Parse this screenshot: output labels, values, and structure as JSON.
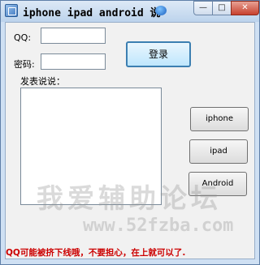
{
  "window": {
    "title": "iphone ipad android 说",
    "min_glyph": "—",
    "max_glyph": "□",
    "close_glyph": "✕"
  },
  "form": {
    "qq_label": "QQ:",
    "qq_value": "",
    "password_label": "密码:",
    "password_value": "",
    "login_button": "登录",
    "post_label": "发表说说：",
    "post_value": ""
  },
  "device_buttons": [
    "iphone",
    "ipad",
    "Android"
  ],
  "watermark": {
    "text": "我爱辅助论坛",
    "url": "www.52fzba.com"
  },
  "notice": "QQ可能被挤下线哦，不要担心，在上就可以了."
}
